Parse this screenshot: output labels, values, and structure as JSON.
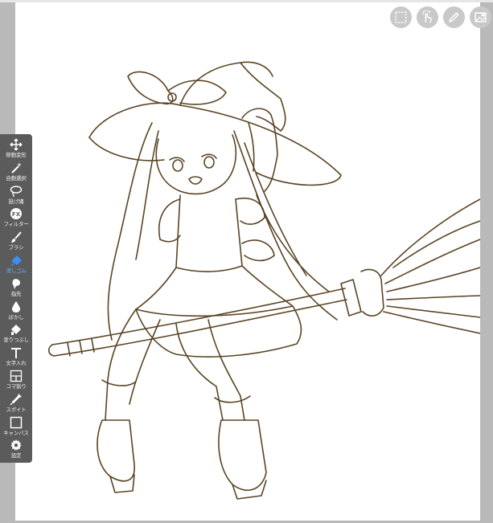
{
  "app": {
    "accent_color": "#3d8ef0",
    "line_color": "#5a4424",
    "toolbar_color": "#5b5b5b"
  },
  "top_buttons": [
    {
      "name": "selection-rect-icon"
    },
    {
      "name": "touch-gesture-icon"
    },
    {
      "name": "pen-edit-icon"
    },
    {
      "name": "layer-image-icon"
    }
  ],
  "toolbar": {
    "active": "eraser",
    "tools": [
      {
        "id": "move",
        "label": "移動変形",
        "icon": "move-arrows-icon"
      },
      {
        "id": "magic",
        "label": "自動選択",
        "icon": "magic-wand-icon"
      },
      {
        "id": "lasso",
        "label": "投げ縄",
        "icon": "lasso-icon"
      },
      {
        "id": "filter",
        "label": "フィルター",
        "icon": "fx-icon"
      },
      {
        "id": "brush",
        "label": "ブラシ",
        "icon": "brush-icon"
      },
      {
        "id": "eraser",
        "label": "消しゴム",
        "icon": "eraser-icon"
      },
      {
        "id": "finger",
        "label": "指先",
        "icon": "finger-smudge-icon"
      },
      {
        "id": "blur",
        "label": "ぼかし",
        "icon": "drop-blur-icon"
      },
      {
        "id": "fill",
        "label": "塗りつぶし",
        "icon": "paint-bucket-icon"
      },
      {
        "id": "text",
        "label": "文字入れ",
        "icon": "text-icon"
      },
      {
        "id": "frame",
        "label": "コマ割り",
        "icon": "frame-divide-icon"
      },
      {
        "id": "eyedropper",
        "label": "スポイト",
        "icon": "eyedropper-icon"
      },
      {
        "id": "canvas",
        "label": "キャンバス",
        "icon": "canvas-icon"
      },
      {
        "id": "settings",
        "label": "設定",
        "icon": "gear-icon"
      }
    ]
  }
}
